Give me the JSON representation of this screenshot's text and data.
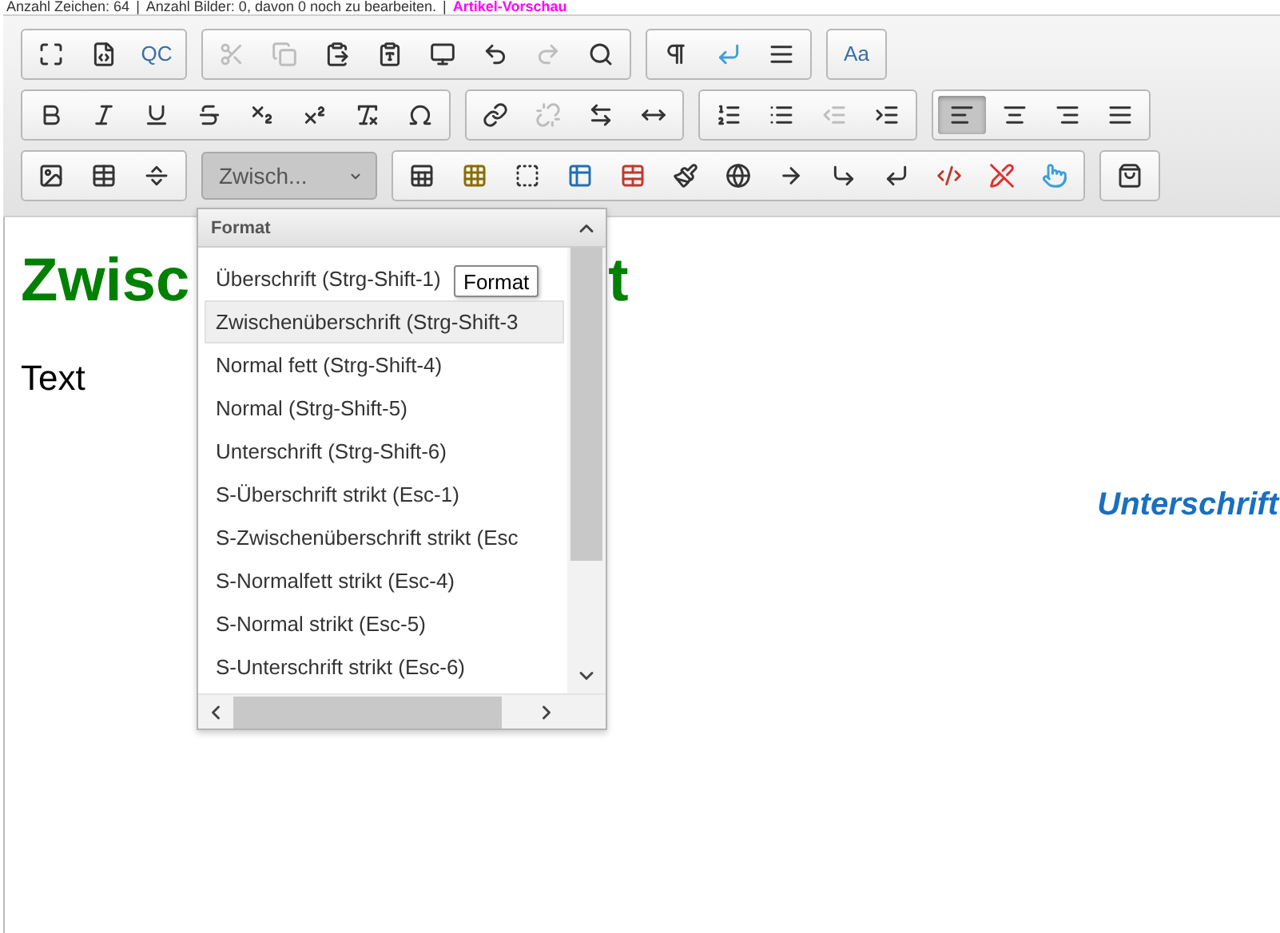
{
  "status_line": [
    {
      "kind": "text",
      "text": "Anzahl Zeichen: 64"
    },
    {
      "kind": "separator",
      "text": "|"
    },
    {
      "kind": "text",
      "text": "Anzahl Bilder: 0, davon 0 noch zu bearbeiten."
    },
    {
      "kind": "separator",
      "text": "|"
    },
    {
      "kind": "link",
      "text": "Artikel-Vorschau"
    }
  ],
  "toolbar": {
    "rows": [
      {
        "groups": [
          {
            "buttons": [
              {
                "kind": "icon",
                "disabled": false,
                "selected": false
              },
              {
                "kind": "icon",
                "disabled": false,
                "selected": false
              },
              {
                "kind": "text",
                "label": "QC",
                "disabled": false,
                "selected": false
              }
            ]
          },
          {
            "buttons": [
              {
                "kind": "icon",
                "disabled": true,
                "selected": false
              },
              {
                "kind": "icon",
                "disabled": true,
                "selected": false
              },
              {
                "kind": "icon",
                "disabled": false,
                "selected": false
              },
              {
                "kind": "icon",
                "disabled": false,
                "selected": false
              },
              {
                "kind": "icon",
                "disabled": false,
                "selected": false
              },
              {
                "kind": "icon",
                "disabled": false,
                "selected": false
              },
              {
                "kind": "icon",
                "disabled": true,
                "selected": false
              },
              {
                "kind": "icon",
                "disabled": false,
                "selected": false
              }
            ]
          },
          {
            "buttons": [
              {
                "kind": "icon",
                "disabled": false,
                "selected": false
              },
              {
                "kind": "icon",
                "disabled": false,
                "selected": false
              },
              {
                "kind": "icon",
                "disabled": false,
                "selected": false
              }
            ]
          },
          {
            "buttons": [
              {
                "kind": "text",
                "label": "Aa",
                "disabled": false,
                "selected": false
              }
            ]
          }
        ]
      },
      {
        "groups": [
          {
            "buttons": [
              {
                "kind": "icon",
                "disabled": false,
                "selected": false
              },
              {
                "kind": "icon",
                "disabled": false,
                "selected": false
              },
              {
                "kind": "icon",
                "disabled": false,
                "selected": false
              },
              {
                "kind": "icon",
                "disabled": false,
                "selected": false
              },
              {
                "kind": "icon",
                "disabled": false,
                "selected": false
              },
              {
                "kind": "icon",
                "disabled": false,
                "selected": false
              },
              {
                "kind": "icon",
                "disabled": false,
                "selected": false
              },
              {
                "kind": "icon",
                "disabled": false,
                "selected": false
              }
            ]
          },
          {
            "buttons": [
              {
                "kind": "icon",
                "disabled": false,
                "selected": false
              },
              {
                "kind": "icon",
                "disabled": true,
                "selected": false
              },
              {
                "kind": "icon",
                "disabled": false,
                "selected": false
              },
              {
                "kind": "icon",
                "disabled": false,
                "selected": false
              }
            ]
          },
          {
            "buttons": [
              {
                "kind": "icon",
                "disabled": false,
                "selected": false
              },
              {
                "kind": "icon",
                "disabled": false,
                "selected": false
              },
              {
                "kind": "icon",
                "disabled": true,
                "selected": false
              },
              {
                "kind": "icon",
                "disabled": false,
                "selected": false
              }
            ]
          },
          {
            "buttons": [
              {
                "kind": "icon",
                "disabled": false,
                "selected": true
              },
              {
                "kind": "icon",
                "disabled": false,
                "selected": false
              },
              {
                "kind": "icon",
                "disabled": false,
                "selected": false
              },
              {
                "kind": "icon",
                "disabled": false,
                "selected": false
              }
            ]
          }
        ]
      },
      {
        "groups": [
          {
            "buttons": [
              {
                "kind": "icon",
                "disabled": false,
                "selected": false
              },
              {
                "kind": "icon",
                "disabled": false,
                "selected": false
              },
              {
                "kind": "icon",
                "disabled": false,
                "selected": false
              }
            ]
          },
          {
            "buttons": [
              {
                "kind": "combo",
                "label": "Zwisch...",
                "disabled": false,
                "selected": true
              }
            ]
          },
          {
            "buttons": [
              {
                "kind": "icon",
                "disabled": false,
                "selected": false
              },
              {
                "kind": "icon",
                "disabled": false,
                "selected": false
              },
              {
                "kind": "icon",
                "disabled": false,
                "selected": false
              },
              {
                "kind": "icon",
                "disabled": false,
                "selected": false
              },
              {
                "kind": "icon",
                "disabled": false,
                "selected": false
              },
              {
                "kind": "icon",
                "disabled": false,
                "selected": false
              },
              {
                "kind": "icon",
                "disabled": false,
                "selected": false
              },
              {
                "kind": "icon",
                "disabled": false,
                "selected": false
              },
              {
                "kind": "icon",
                "disabled": false,
                "selected": false
              },
              {
                "kind": "icon",
                "disabled": false,
                "selected": false
              },
              {
                "kind": "icon",
                "disabled": false,
                "selected": false
              },
              {
                "kind": "icon",
                "disabled": false,
                "selected": false
              },
              {
                "kind": "icon",
                "disabled": false,
                "selected": false
              }
            ]
          },
          {
            "buttons": [
              {
                "kind": "icon",
                "disabled": false,
                "selected": false
              }
            ]
          }
        ]
      }
    ]
  },
  "editor": {
    "heading_parts": [
      "Zwisc",
      "t"
    ],
    "paragraph": "Text",
    "caption": "Unterschrift"
  },
  "format_dropdown": {
    "title": "Format",
    "tooltip": "Format",
    "items": [
      {
        "label": "Überschrift (Strg-Shift-1)",
        "selected": false
      },
      {
        "label": "Zwischenüberschrift (Strg-Shift-3",
        "selected": true
      },
      {
        "label": "Normal fett (Strg-Shift-4)",
        "selected": false
      },
      {
        "label": "Normal (Strg-Shift-5)",
        "selected": false
      },
      {
        "label": "Unterschrift (Strg-Shift-6)",
        "selected": false
      },
      {
        "label": "S-Überschrift strikt (Esc-1)",
        "selected": false
      },
      {
        "label": "S-Zwischenüberschrift strikt (Esc",
        "selected": false
      },
      {
        "label": "S-Normalfett strikt (Esc-4)",
        "selected": false
      },
      {
        "label": "S-Normal strikt (Esc-5)",
        "selected": false
      },
      {
        "label": "S-Unterschrift strikt (Esc-6)",
        "selected": false
      }
    ]
  }
}
